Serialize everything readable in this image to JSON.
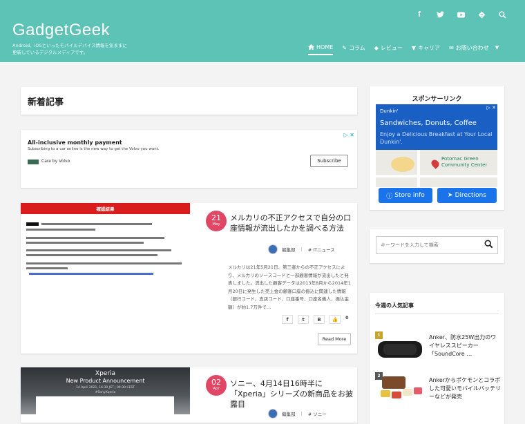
{
  "site": {
    "title": "GadgetGeek",
    "tagline": "Android、iOSといったモバイルデバイス情報を気ままに更新しているデジタルメディアです。"
  },
  "social_icons": [
    "facebook-icon",
    "twitter-icon",
    "youtube-icon",
    "feedly-icon",
    "search-icon"
  ],
  "nav": {
    "items": [
      {
        "label": "HOME",
        "icon": "home-icon"
      },
      {
        "label": "コラム",
        "icon": "column-icon"
      },
      {
        "label": "レビュー",
        "icon": "review-icon"
      },
      {
        "label": "キャリア",
        "icon": "carrier-icon"
      },
      {
        "label": "お問い合わせ",
        "icon": "mail-icon"
      }
    ]
  },
  "main": {
    "heading": "新着記事",
    "ad": {
      "title": "All-inclusive monthly payment",
      "subtitle": "Subscribing to a car online is the new way to get the Volvo you want.",
      "brand": "Care by Volvo",
      "button": "Subscribe"
    },
    "articles": [
      {
        "day": "21",
        "month": "May",
        "title": "メルカリの不正アクセスで自分の口座情報が流出したかを調べる方法",
        "author": "編集部",
        "tag": "# ITニュース",
        "excerpt": "メルカリは21年5月21日、第三者からの不正アクセスにより、メルカリのソースコードと一部顧客情報が流出したと発表しました。流出した顧客データは2013年8月から2014年1月20日に発生した売上金の顧客口座の振込に関連した情報（銀行コード、支店コード、口座番号、口座名義人、振込金額）が約1.7万件で…",
        "share_count": "0",
        "read_more": "Read More",
        "thumb_header": "確認結果"
      },
      {
        "day": "02",
        "month": "Apr",
        "title": "ソニー、4月14日16時半に「Xperia」シリーズの新商品をお披露目",
        "author": "編集部",
        "tag": "# ソニー",
        "thumb_line1": "Xperia",
        "thumb_line2": "New Product Announcement",
        "thumb_line3": "14 April 2021, 16:30 JST | 09:30 CEST",
        "thumb_line4": "#SonyXperia"
      }
    ]
  },
  "sidebar": {
    "sponsor_title": "スポンサーリンク",
    "sponsor_ad": {
      "brand": "Dunkin'",
      "headline": "Sandwiches, Donuts, Coffee",
      "body": "Enjoy a Delicious Breakfast at Your Local Dunkin'.",
      "map_label": "Potomac Green Community Center",
      "store_button": "Store info",
      "directions_button": "Directions"
    },
    "search_placeholder": "キーワードを入力して検索",
    "popular_title": "今週の人気記事",
    "popular": [
      {
        "rank": "1",
        "title": "Anker、防水25W出力のワイヤレススピーカー「SoundCore …"
      },
      {
        "rank": "2",
        "title": "Ankerからポケモンとコラボした可愛いモバイルバッテリーなどが発売"
      }
    ]
  },
  "colors": {
    "header": "#5cc3b6",
    "date_badge": "#e14664",
    "ad_blue": "#1a5fc4",
    "button_blue": "#1a73e8"
  }
}
